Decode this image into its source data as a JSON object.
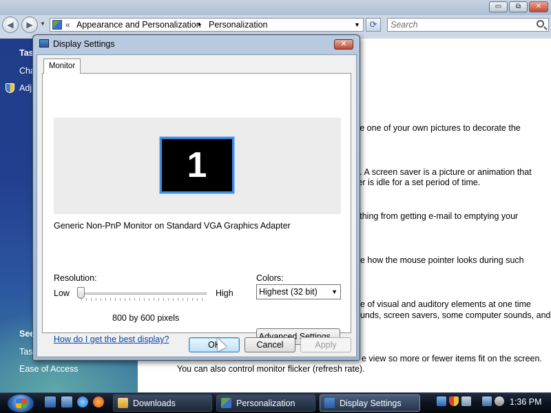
{
  "explorer": {
    "breadcrumb_prefix": "«",
    "breadcrumb_1": "Appearance and Personalization",
    "breadcrumb_sep": "▸",
    "breadcrumb_2": "Personalization",
    "search_placeholder": "Search",
    "window_controls": {
      "minimize": "▭",
      "maximize": "⧉",
      "close": "✕"
    },
    "left_pane": {
      "tasks_heading": "Tas",
      "items": [
        "Cha",
        "Adj"
      ],
      "see_also": "See",
      "see_also_items": [
        "Tas",
        "Ease of Access"
      ]
    },
    "content_lines": [
      "se one of your own pictures to decorate the",
      "s. A screen saver is a picture or animation that",
      "ter is idle for a set period of time.",
      "ything from getting e-mail to emptying your",
      "ge how the mouse pointer looks during such",
      "ge of visual and auditory elements at one time",
      "ounds, screen savers, some computer sounds, and",
      "e view so more or fewer items fit on the screen.",
      "You can also control monitor flicker (refresh rate)."
    ]
  },
  "dialog": {
    "title": "Display Settings",
    "close_label": "✕",
    "tab_label": "Monitor",
    "monitor_number": "1",
    "monitor_description": "Generic Non-PnP Monitor on Standard VGA Graphics Adapter",
    "resolution": {
      "label": "Resolution:",
      "low": "Low",
      "high": "High",
      "value_text": "800 by 600 pixels",
      "slider_position": 0
    },
    "colors": {
      "label": "Colors:",
      "selected": "Highest (32 bit)"
    },
    "help_link": "How do I get the best display?",
    "advanced_button": "Advanced Settings...",
    "ok_button": "OK",
    "cancel_button": "Cancel",
    "apply_button": "Apply"
  },
  "taskbar": {
    "buttons": [
      {
        "label": "Downloads"
      },
      {
        "label": "Personalization"
      },
      {
        "label": "Display Settings"
      }
    ],
    "clock": "1:36 PM"
  },
  "colors": {
    "dialog_frame": "#9fb6d1",
    "monitor_border": "#3b8ee8",
    "link": "#0645ad",
    "taskbar": "#0c1420"
  }
}
